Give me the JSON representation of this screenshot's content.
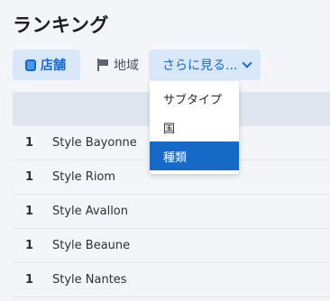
{
  "page": {
    "title": "ランキング"
  },
  "tabs": {
    "store": {
      "label": "店舗",
      "icon": "store-icon",
      "active": true
    },
    "region": {
      "label": "地域",
      "icon": "flag-icon"
    },
    "more": {
      "label": "さらに見る...",
      "icon": "chevron-down-icon"
    }
  },
  "dropdown": {
    "items": [
      {
        "label": "サブタイプ",
        "selected": false
      },
      {
        "label": "国",
        "selected": false
      },
      {
        "label": "種類",
        "selected": true
      }
    ]
  },
  "ranking": {
    "rows": [
      {
        "rank": "1",
        "name": "Style Bayonne"
      },
      {
        "rank": "1",
        "name": "Style Riom"
      },
      {
        "rank": "1",
        "name": "Style Avallon"
      },
      {
        "rank": "1",
        "name": "Style Beaune"
      },
      {
        "rank": "1",
        "name": "Style Nantes"
      }
    ]
  },
  "colors": {
    "accent": "#1869c7",
    "accent_light": "#d9e8f9",
    "selected_bg": "#1769c8",
    "background": "#f3f5f8",
    "header_bg": "#dfe6ef"
  }
}
